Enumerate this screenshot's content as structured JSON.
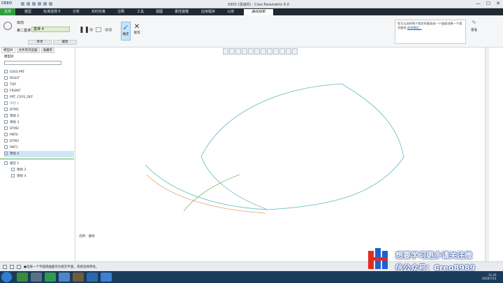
{
  "window": {
    "app_logo": "CREO",
    "title": "0303 (活动的) - Creo Parametric 6.0",
    "min": "—",
    "max": "☐",
    "close": "✕"
  },
  "menu": {
    "file": "文件",
    "items": [
      "模型",
      "标准选择卡",
      "分析",
      "实时仿真",
      "注释",
      "工具",
      "视图",
      "柔性建模",
      "应用程序",
      "公用"
    ],
    "active": "曲线投影"
  },
  "ribbon": {
    "ref_label": "目前",
    "second_label": "第二基准",
    "field_value": "基准 4",
    "tabs": [
      "参考",
      "属性"
    ],
    "ok_label": "确定",
    "cancel_label": "取消",
    "tip_text": "您可以选择两个相交的基准或一个曲面创建一个相交曲线",
    "tip_link": "选择确定。",
    "wave_label": "基准"
  },
  "sidebar": {
    "tabs": [
      "模型树",
      "文件夹浏览器",
      "收藏夹"
    ],
    "title": "模型树",
    "root": "0303.PRT",
    "items": [
      "RIGHT",
      "TOP",
      "FRONT",
      "PRT_CSYS_DEF",
      "草绘 1",
      "DTM1",
      "草绘 2",
      "草绘 3",
      "DTM2",
      "PNT0",
      "DTM3",
      "PNT1",
      "草绘 4"
    ],
    "group": "相交 1",
    "sub_items": [
      "草绘 3",
      "草绘 4"
    ]
  },
  "canvas": {
    "mode": "选择：曲线"
  },
  "status": {
    "message": "●选择一个平面或曲面作为相交平面，或者选择草绘。"
  },
  "taskbar": {
    "time": "11:26",
    "date": "2020/7/14"
  },
  "watermark": {
    "line1": "想要学习更多请关注微",
    "line2": "信公众号：Creo8989"
  },
  "colors": {
    "accent": "#2e9f3d",
    "curve_teal": "#5fb9bf",
    "curve_orange": "#e8a46a",
    "curve_green": "#7cc06a"
  }
}
